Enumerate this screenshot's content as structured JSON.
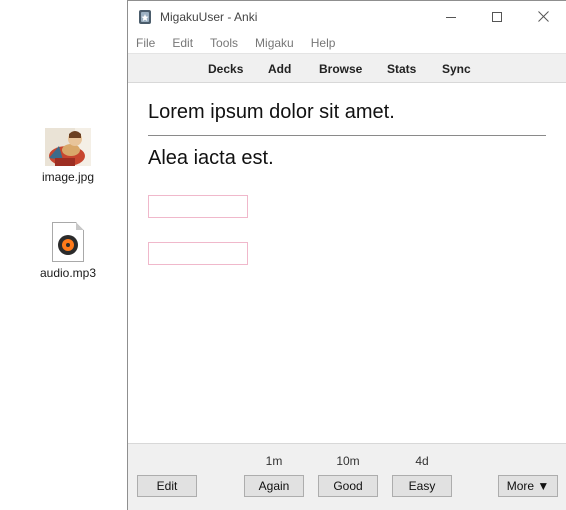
{
  "desktop": {
    "icons": [
      {
        "label": "image.jpg",
        "icon": "image-file-icon"
      },
      {
        "label": "audio.mp3",
        "icon": "audio-file-icon"
      }
    ]
  },
  "window": {
    "title": "MigakuUser - Anki",
    "icon": "anki-app-icon",
    "controls": [
      "minimize-icon",
      "maximize-icon",
      "close-icon"
    ]
  },
  "menu": {
    "items": [
      "File",
      "Edit",
      "Tools",
      "Migaku",
      "Help"
    ]
  },
  "toolbar": {
    "items": [
      "Decks",
      "Add",
      "Browse",
      "Stats",
      "Sync"
    ]
  },
  "card": {
    "front": "Lorem ipsum dolor sit amet.",
    "back": "Alea iacta est.",
    "accent_border": "#f0b8cb"
  },
  "review": {
    "edit_label": "Edit",
    "answers": [
      {
        "label": "Again",
        "interval": "1m"
      },
      {
        "label": "Good",
        "interval": "10m"
      },
      {
        "label": "Easy",
        "interval": "4d"
      }
    ],
    "more_label": "More ▼"
  }
}
